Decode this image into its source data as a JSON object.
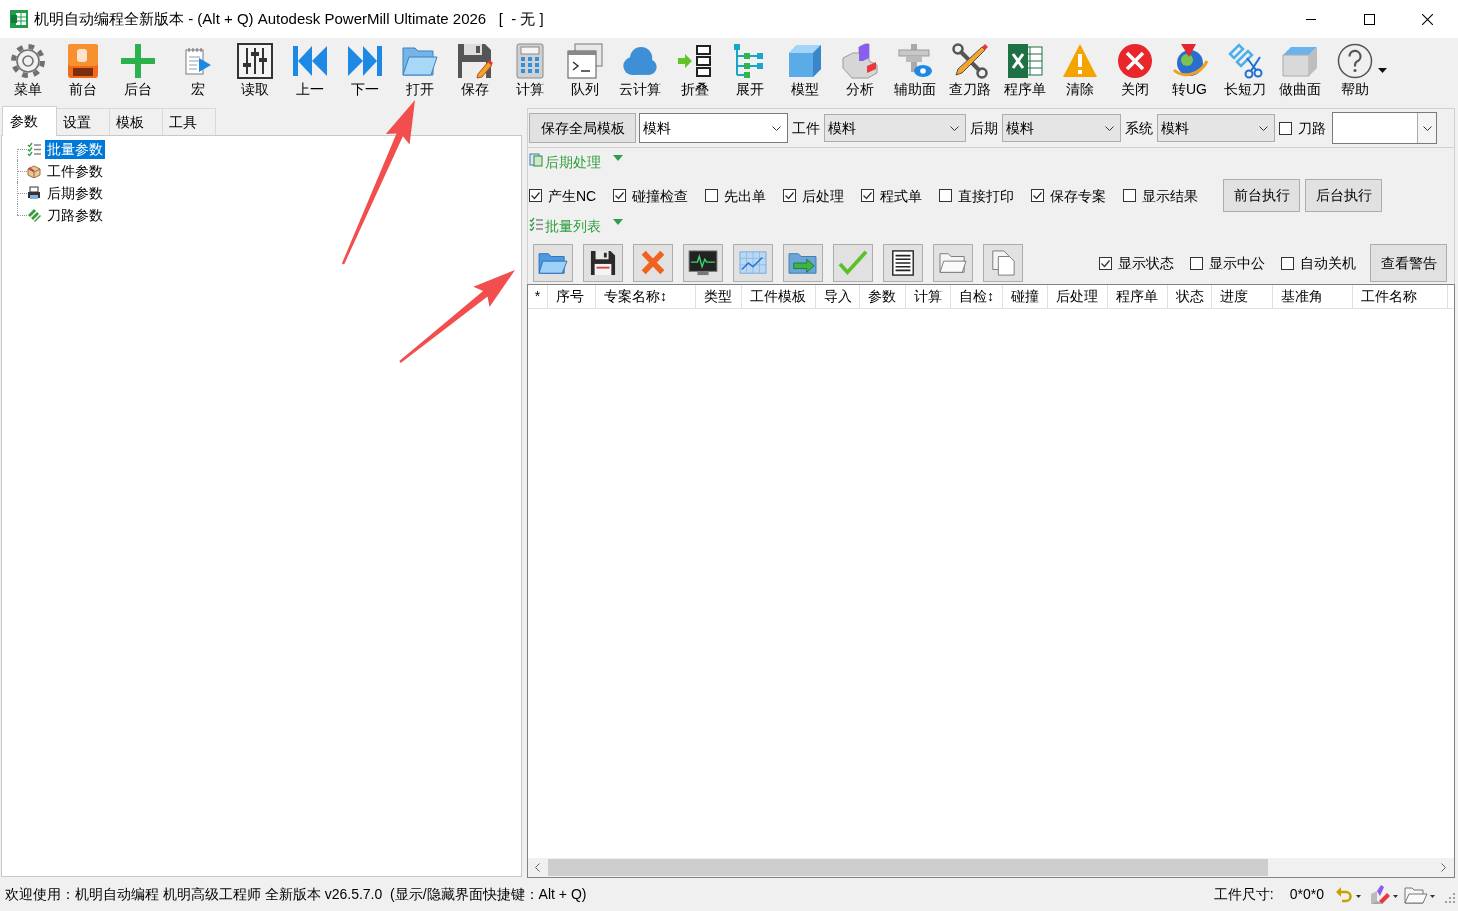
{
  "window": {
    "title": "机明自动编程全新版本 - (Alt + Q) Autodesk PowerMill Ultimate 2026   [  - 无 ]"
  },
  "toolbar": [
    "菜单",
    "前台",
    "后台",
    "宏",
    "读取",
    "上一",
    "下一",
    "打开",
    "保存",
    "计算",
    "队列",
    "云计算",
    "折叠",
    "展开",
    "模型",
    "分析",
    "辅助面",
    "查刀路",
    "程序单",
    "清除",
    "关闭",
    "转UG",
    "长短刀",
    "做曲面",
    "帮助"
  ],
  "left_panel": {
    "tabs": [
      {
        "label": "参数",
        "selected": true
      },
      {
        "label": "设置",
        "selected": false
      },
      {
        "label": "模板",
        "selected": false
      },
      {
        "label": "工具",
        "selected": false
      }
    ],
    "tree": [
      {
        "label": "批量参数",
        "selected": true
      },
      {
        "label": "工件参数",
        "selected": false
      },
      {
        "label": "后期参数",
        "selected": false
      },
      {
        "label": "刀路参数",
        "selected": false
      }
    ]
  },
  "template_bar": {
    "save_button": "保存全局模板",
    "template_value": "模料",
    "selectors": [
      {
        "label": "工件",
        "value": "模料"
      },
      {
        "label": "后期",
        "value": "模料"
      },
      {
        "label": "系统",
        "value": "模料"
      }
    ],
    "toolpath": {
      "label": "刀路",
      "checked": false
    }
  },
  "post_section": {
    "title": "后期处理",
    "expanded": true,
    "options": [
      {
        "label": "产生NC",
        "checked": true
      },
      {
        "label": "碰撞检查",
        "checked": true
      },
      {
        "label": "先出单",
        "checked": false
      },
      {
        "label": "后处理",
        "checked": true
      },
      {
        "label": "程式单",
        "checked": true
      },
      {
        "label": "直接打印",
        "checked": false
      },
      {
        "label": "保存专案",
        "checked": true
      },
      {
        "label": "显示结果",
        "checked": false
      }
    ],
    "buttons": [
      "前台执行",
      "后台执行"
    ]
  },
  "batch_section": {
    "title": "批量列表",
    "expanded": true,
    "options": [
      {
        "label": "显示状态",
        "checked": true
      },
      {
        "label": "显示中公",
        "checked": false
      },
      {
        "label": "自动关机",
        "checked": false
      }
    ],
    "warning_button": "查看警告"
  },
  "table": {
    "columns": [
      "*",
      "序号",
      "专案名称↕",
      "类型",
      "工件模板",
      "导入",
      "参数",
      "计算",
      "自检↕",
      "碰撞",
      "后处理",
      "程序单",
      "状态",
      "进度",
      "基准角",
      "工件名称"
    ]
  },
  "status_bar": {
    "message": "欢迎使用：机明自动编程 机明高级工程师 全新版本 v26.5.7.0  (显示/隐藏界面快捷键：Alt + Q)",
    "size_label": "工件尺寸:",
    "size_value": "0*0*0"
  }
}
